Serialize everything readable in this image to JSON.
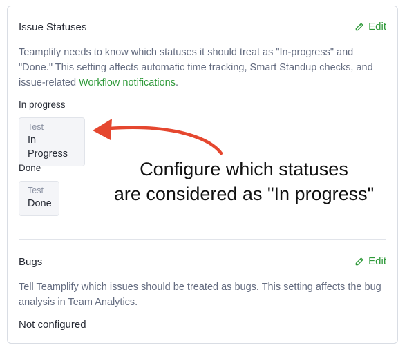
{
  "issue_statuses": {
    "title": "Issue Statuses",
    "edit_label": "Edit",
    "description_prefix": "Teamplify needs to know which statuses it should treat as \"In-progress\" and \"Done.\" This setting affects automatic time tracking, Smart Standup checks, and issue-related ",
    "description_link": "Workflow notifications",
    "description_suffix": ".",
    "in_progress": {
      "label": "In progress",
      "project": "Test",
      "status": "In Progress"
    },
    "done": {
      "label": "Done",
      "project": "Test",
      "status": "Done"
    }
  },
  "bugs": {
    "title": "Bugs",
    "edit_label": "Edit",
    "description": "Tell Teamplify which issues should be treated as bugs. This setting affects the bug analysis in Team Analytics.",
    "value": "Not configured"
  },
  "annotation": {
    "line1": "Configure which statuses",
    "line2": "are considered as \"In progress\""
  },
  "colors": {
    "accent_green": "#2f9a3a",
    "arrow_red": "#e5472f"
  },
  "icons": {
    "edit": "pencil-icon"
  }
}
